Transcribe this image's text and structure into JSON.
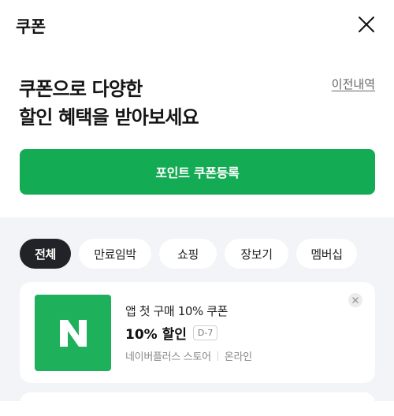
{
  "header": {
    "title": "쿠폰",
    "close_icon": "close-icon"
  },
  "hero": {
    "line1": "쿠폰으로 다양한",
    "line2": "할인 혜택을 받아보세요",
    "history_link": "이전내역"
  },
  "register_button": {
    "label": "포인트 쿠폰등록",
    "color": "#14ab55"
  },
  "filter_chips": {
    "items": [
      "전체",
      "만료임박",
      "쇼핑",
      "장보기",
      "멤버십"
    ],
    "selected": "전체"
  },
  "coupons": [
    {
      "logo_letter": "N",
      "logo_color": "#1fb05b",
      "title": "앱 첫 구매 10% 쿠폰",
      "discount": "10% 할인",
      "dday": "D-7",
      "store": "네이버플러스 스토어",
      "channel": "온라인"
    }
  ]
}
